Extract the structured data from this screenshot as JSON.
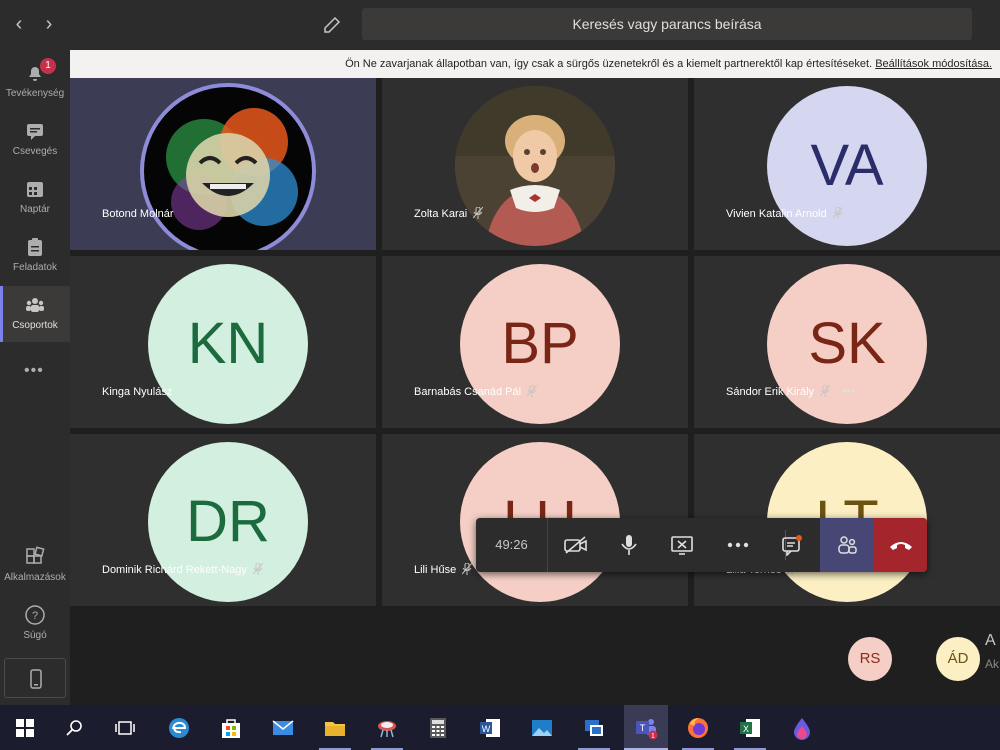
{
  "search": {
    "placeholder": "Keresés vagy parancs beírása"
  },
  "rail": {
    "activity": {
      "label": "Tevékenység",
      "badge": "1"
    },
    "chat": {
      "label": "Csevegés"
    },
    "calendar": {
      "label": "Naptár"
    },
    "assignments": {
      "label": "Feladatok"
    },
    "teams": {
      "label": "Csoportok"
    },
    "more": "•••",
    "apps": {
      "label": "Alkalmazások"
    },
    "help": {
      "label": "Súgó"
    }
  },
  "banner": {
    "text": "Ön Ne zavarjanak állapotban van, így csak a sürgős üzenetekről és a kiemelt partnerektől kap értesítéseket. ",
    "link": "Beállítások módosítása."
  },
  "participants": [
    {
      "name": "Botond Molnár",
      "initials": "",
      "type": "photo-emoji",
      "speaking": true,
      "muted": false
    },
    {
      "name": "Zolta Karai",
      "initials": "",
      "type": "photo-child",
      "speaking": false,
      "muted": true
    },
    {
      "name": "Vivien Katalin Arnold",
      "initials": "VA",
      "bg": "#d5d7f0",
      "fg": "#2b2d6b",
      "muted": true
    },
    {
      "name": "Kinga Nyulász",
      "initials": "KN",
      "bg": "#d2efe0",
      "fg": "#1c6b3e",
      "muted": false
    },
    {
      "name": "Barnabás Csanád Pál",
      "initials": "BP",
      "bg": "#f5cfc6",
      "fg": "#7a2617",
      "muted": true
    },
    {
      "name": "Sándor Erik Király",
      "initials": "SK",
      "bg": "#f5cfc6",
      "fg": "#7a2617",
      "muted": true,
      "more": "•••"
    },
    {
      "name": "Dominik Richárd Rekett-Nagy",
      "initials": "DR",
      "bg": "#d2efe0",
      "fg": "#1c6b3e",
      "muted": true
    },
    {
      "name": "Lili Hűse",
      "initials": "LH",
      "bg": "#f5cfc6",
      "fg": "#7a2617",
      "muted": true
    },
    {
      "name": "Lilla Ternes",
      "initials": "LT",
      "bg": "#fbefc3",
      "fg": "#6b5312",
      "muted": true
    }
  ],
  "callbar": {
    "timer": "49:26"
  },
  "overflow": [
    {
      "initials": "RS",
      "bg": "#f5cfc6"
    },
    {
      "initials": "ÁD",
      "bg": "#fbefc3"
    }
  ],
  "overflow_cut": {
    "line1": "A",
    "line2": "Ak"
  },
  "colors": {
    "accent": "#7b83eb",
    "hangup": "#a4262c",
    "participants_button": "#464775"
  }
}
